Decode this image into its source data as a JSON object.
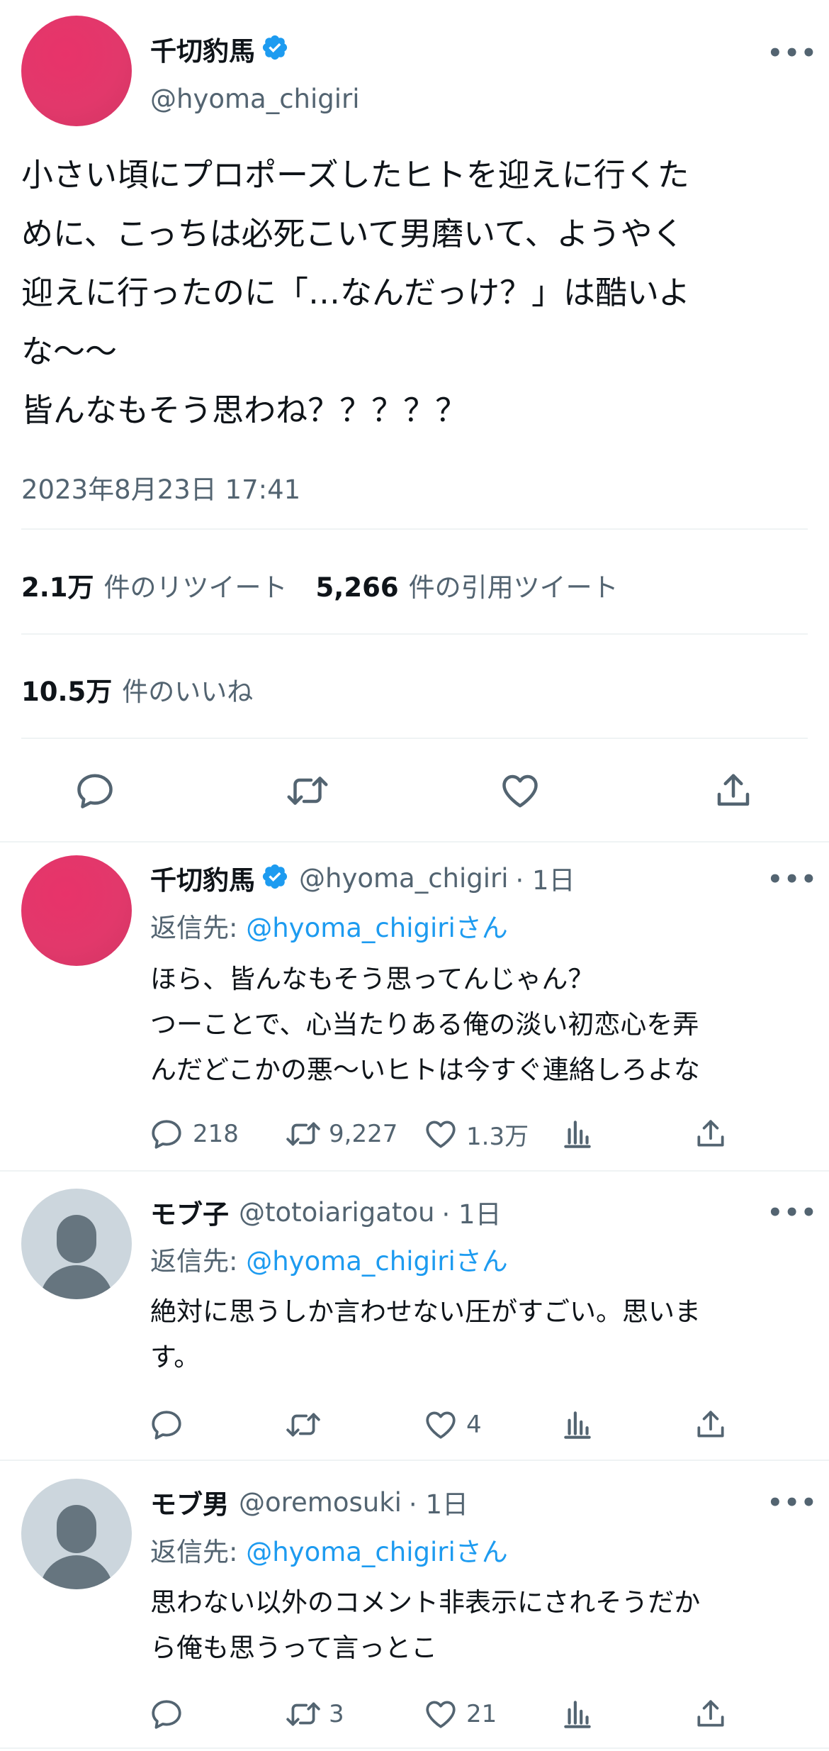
{
  "main_tweet": {
    "author_name": "千切豹馬",
    "handle": "@hyoma_chigiri",
    "text_lines": [
      "小さい頃にプロポーズしたヒトを迎えに行くた",
      "めに、こっちは必死こいて男磨いて、ようやく",
      "迎えに行ったのに「…なんだっけ？」は酷いよ",
      "な〜〜",
      "皆んなもそう思わね？？？？？"
    ],
    "timestamp": "2023年8月23日 17:41",
    "retweets_count": "2.1万",
    "retweets_label": "件のリツイート",
    "quotes_count": "5,266",
    "quotes_label": "件の引用ツイート",
    "likes_count": "10.5万",
    "likes_label": "件のいいね"
  },
  "replies": [
    {
      "author_name": "千切豹馬",
      "handle": "@hyoma_chigiri",
      "time": "· 1日",
      "replying_prefix": "返信先: ",
      "replying_to": "@hyoma_chigiriさん",
      "text_lines": [
        "ほら、皆んなもそう思ってんじゃん？",
        "つーことで、心当たりある俺の淡い初恋心を弄",
        "んだどこかの悪〜いヒトは今すぐ連絡しろよな"
      ],
      "reply_count": "218",
      "retweet_count": "9,227",
      "like_count": "1.3万"
    },
    {
      "author_name": "モブ子",
      "handle": "@totoiarigatou",
      "time": "· 1日",
      "replying_prefix": "返信先: ",
      "replying_to": "@hyoma_chigiriさん",
      "text_lines": [
        "絶対に思うしか言わせない圧がすごい。思いま",
        "す。"
      ],
      "reply_count": "",
      "retweet_count": "",
      "like_count": "4"
    },
    {
      "author_name": "モブ男",
      "handle": "@oremosuki",
      "time": "· 1日",
      "replying_prefix": "返信先: ",
      "replying_to": "@hyoma_chigiriさん",
      "text_lines": [
        "思わない以外のコメント非表示にされそうだか",
        "ら俺も思うって言っとこ"
      ],
      "reply_count": "",
      "retweet_count": "3",
      "like_count": "21"
    }
  ],
  "icons": {
    "more": "more-horizontal-icon",
    "verified": "verified-badge-icon",
    "reply": "reply-bubble-icon",
    "retweet": "retweet-arrows-icon",
    "like": "heart-icon",
    "views": "analytics-bars-icon",
    "share": "share-upload-icon"
  },
  "colors": {
    "link": "#1d9bf0",
    "verified": "#1d9bf0",
    "secondary_text": "#536471",
    "avatar_pink": "#e2386b",
    "default_avatar_bg": "#ccd6dd"
  },
  "more_glyph": "•••"
}
